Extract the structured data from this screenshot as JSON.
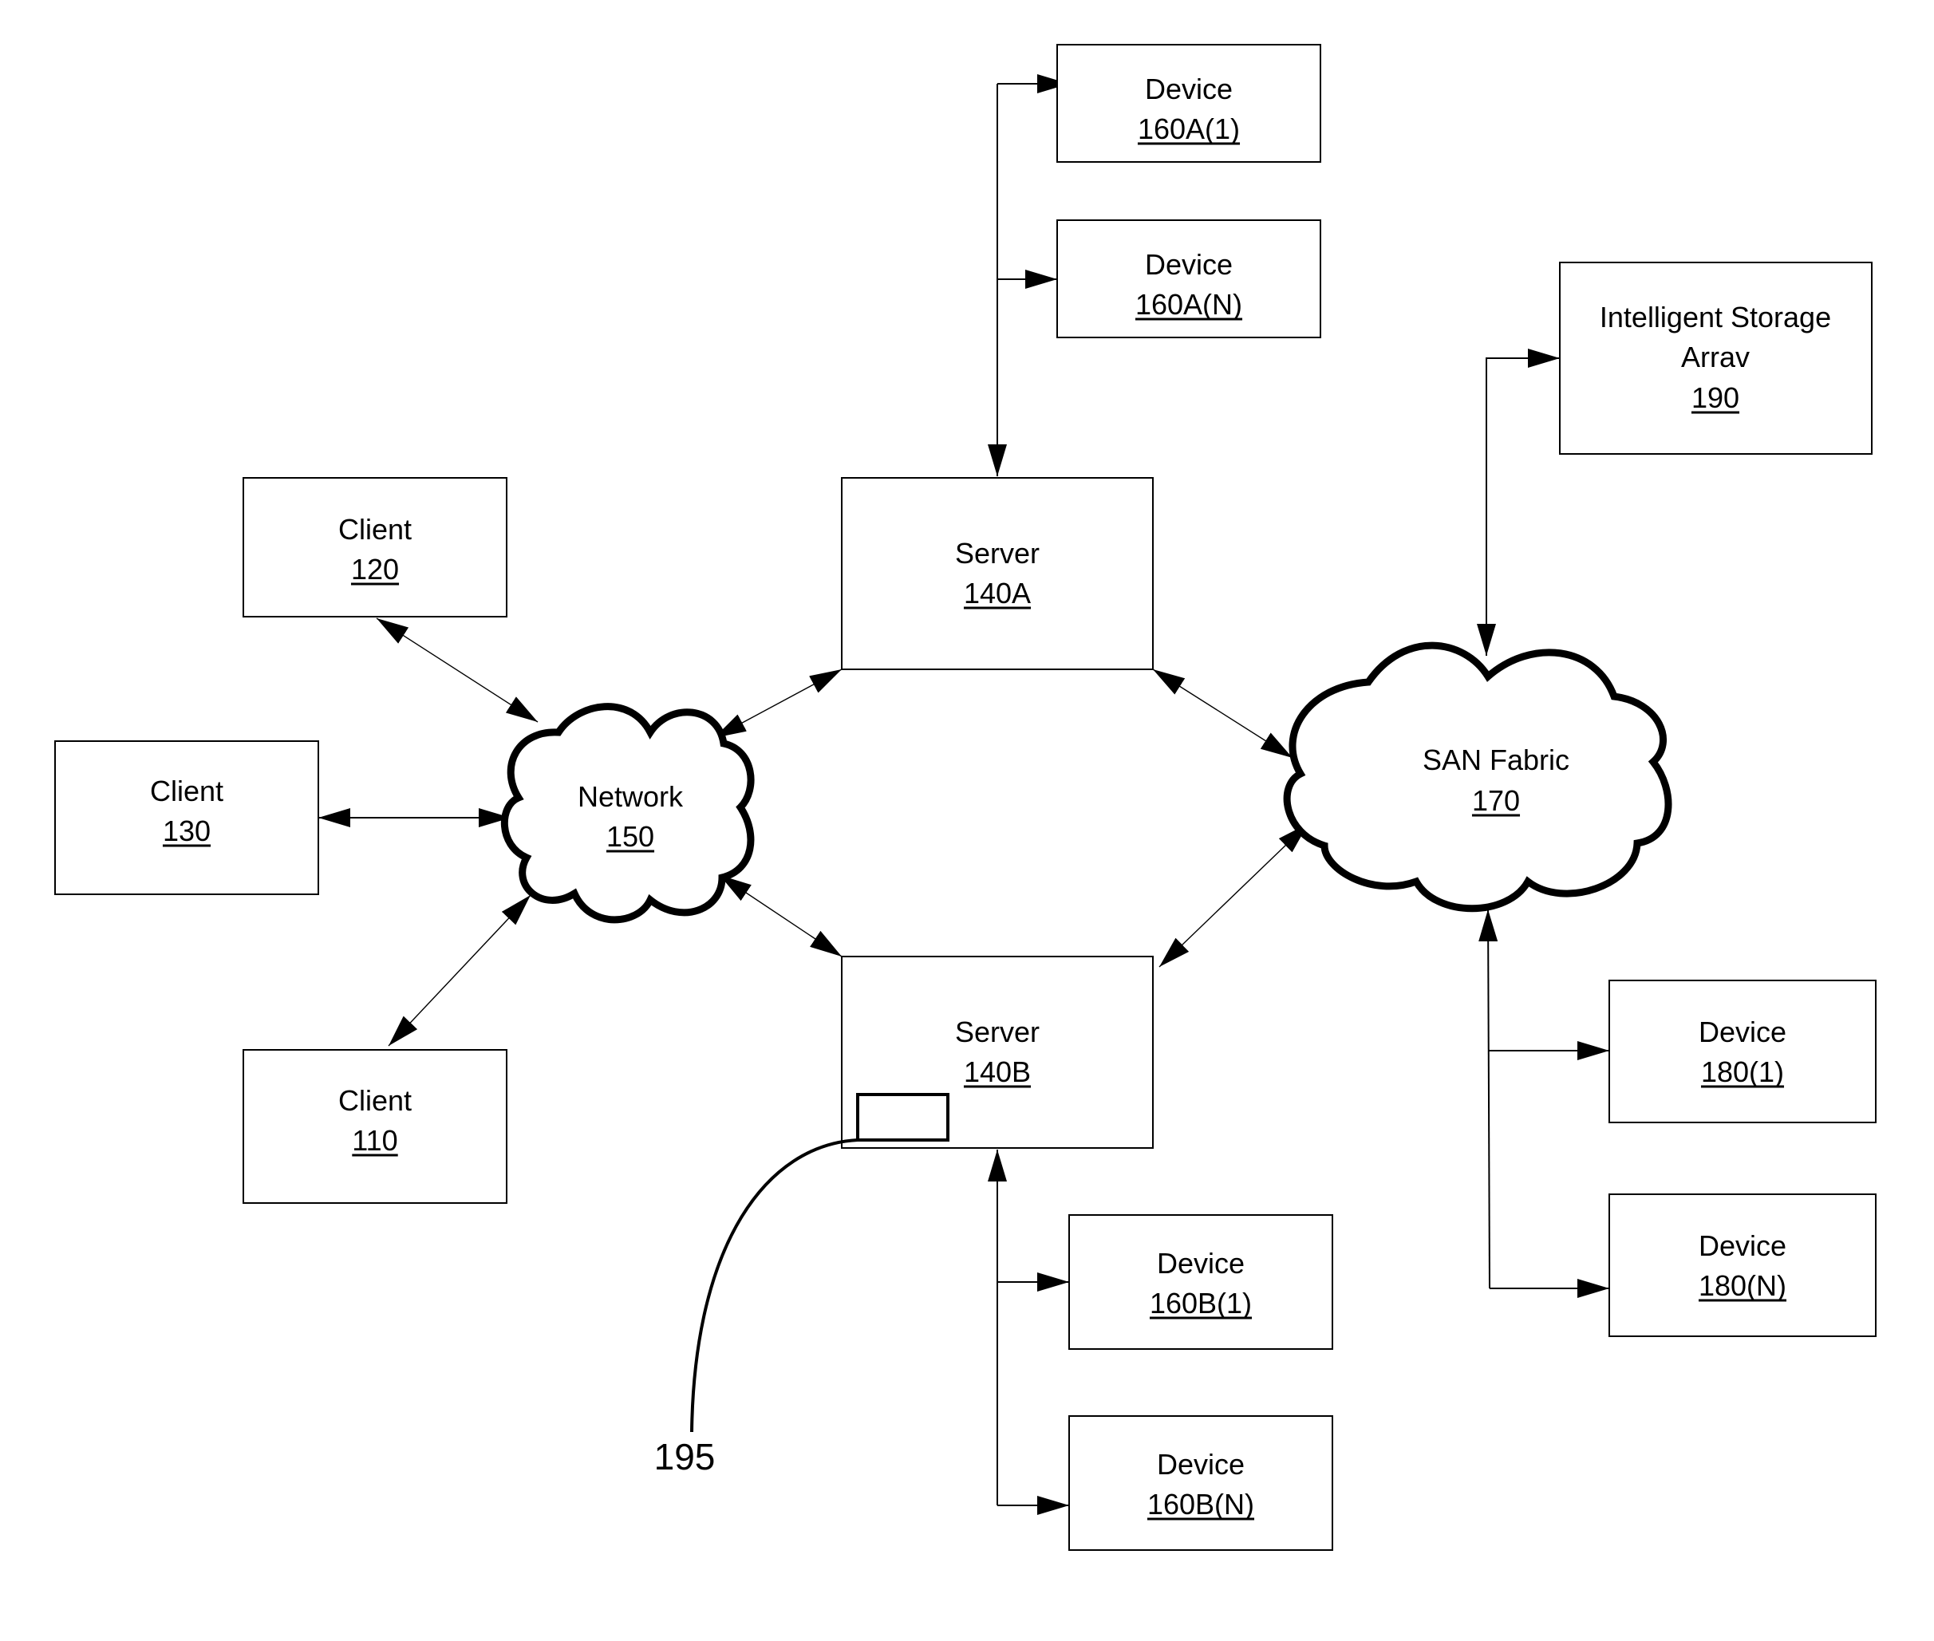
{
  "diagram": {
    "nodes": {
      "client_120": {
        "title": "Client",
        "ref": "120"
      },
      "client_130": {
        "title": "Client",
        "ref": "130"
      },
      "client_110": {
        "title": "Client",
        "ref": "110"
      },
      "network_150": {
        "title": "Network",
        "ref": "150"
      },
      "server_140a": {
        "title": "Server",
        "ref": "140A"
      },
      "server_140b": {
        "title": "Server",
        "ref": "140B"
      },
      "device_160a1": {
        "title": "Device",
        "ref": "160A(1)"
      },
      "device_160an": {
        "title": "Device",
        "ref": "160A(N)"
      },
      "device_160b1": {
        "title": "Device",
        "ref": "160B(1)"
      },
      "device_160bn": {
        "title": "Device",
        "ref": "160B(N)"
      },
      "san_170": {
        "title": "SAN Fabric",
        "ref": "170"
      },
      "storage_190": {
        "title_line1": "Intelligent Storage",
        "title_line2": "Arrav",
        "ref": "190"
      },
      "device_1801": {
        "title": "Device",
        "ref": "180(1)"
      },
      "device_180n": {
        "title": "Device",
        "ref": "180(N)"
      }
    },
    "callout": {
      "label": "195",
      "target": "server_140b"
    },
    "edges": [
      {
        "from": "client_120",
        "to": "network_150",
        "type": "bidirectional"
      },
      {
        "from": "client_130",
        "to": "network_150",
        "type": "bidirectional"
      },
      {
        "from": "client_110",
        "to": "network_150",
        "type": "bidirectional"
      },
      {
        "from": "network_150",
        "to": "server_140a",
        "type": "bidirectional"
      },
      {
        "from": "network_150",
        "to": "server_140b",
        "type": "bidirectional"
      },
      {
        "from": "server_140a",
        "to": "san_170",
        "type": "bidirectional"
      },
      {
        "from": "server_140b",
        "to": "san_170",
        "type": "bidirectional"
      },
      {
        "from": "server_140a",
        "to": "device_160a1",
        "type": "bus"
      },
      {
        "from": "server_140a",
        "to": "device_160an",
        "type": "bus"
      },
      {
        "from": "server_140b",
        "to": "device_160b1",
        "type": "bus"
      },
      {
        "from": "server_140b",
        "to": "device_160bn",
        "type": "bus"
      },
      {
        "from": "san_170",
        "to": "storage_190",
        "type": "bus"
      },
      {
        "from": "san_170",
        "to": "device_1801",
        "type": "bus"
      },
      {
        "from": "san_170",
        "to": "device_180n",
        "type": "bus"
      }
    ]
  }
}
